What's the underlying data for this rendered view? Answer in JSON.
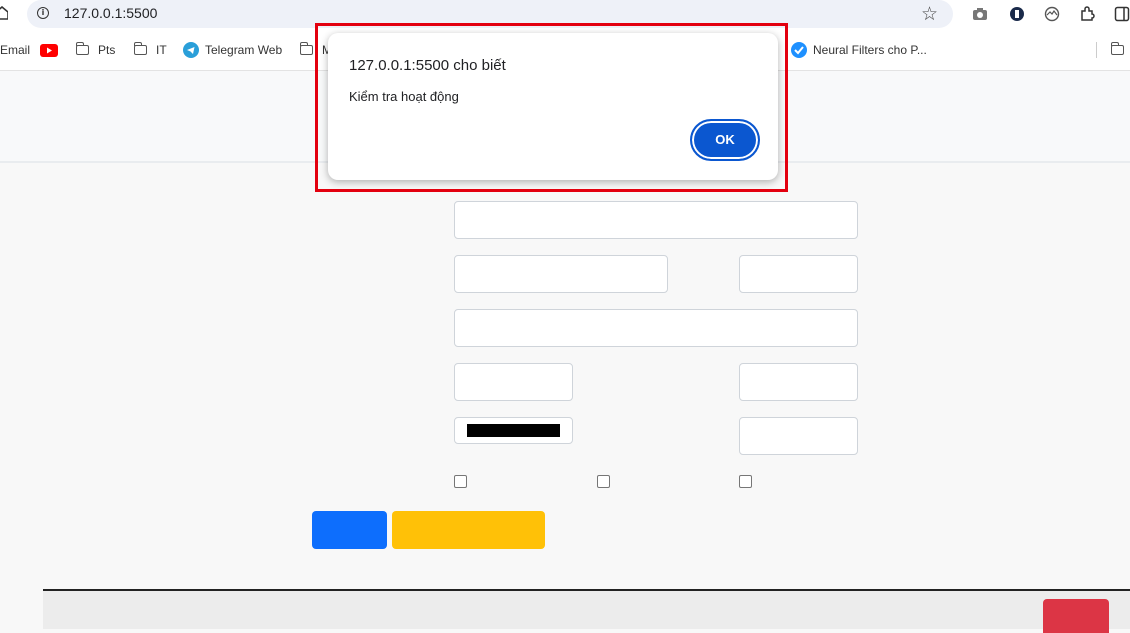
{
  "browser": {
    "url": "127.0.0.1:5500",
    "bookmarks": [
      {
        "label": "Email",
        "icon": "mail-icon"
      },
      {
        "label": "",
        "icon": "youtube-icon"
      },
      {
        "label": "Pts",
        "icon": "folder-icon"
      },
      {
        "label": "IT",
        "icon": "folder-icon"
      },
      {
        "label": "Telegram Web",
        "icon": "telegram-icon"
      },
      {
        "label": "M",
        "icon": "folder-icon"
      },
      {
        "label": "Neural Filters cho P...",
        "icon": "neural-filters-icon"
      },
      {
        "label": "",
        "icon": "folder-icon"
      }
    ]
  },
  "dialog": {
    "title": "127.0.0.1:5500 cho biết",
    "message": "Kiểm tra hoạt động",
    "ok_label": "OK"
  },
  "form": {
    "color_value": "#000000",
    "buttons": [
      {
        "name": "primary-button",
        "color": "#0d6efd"
      },
      {
        "name": "warning-button",
        "color": "#ffc107"
      },
      {
        "name": "danger-button",
        "color": "#dc3545"
      }
    ]
  },
  "colors": {
    "highlight_border": "#e3000f",
    "ok_button": "#0b57d0"
  }
}
